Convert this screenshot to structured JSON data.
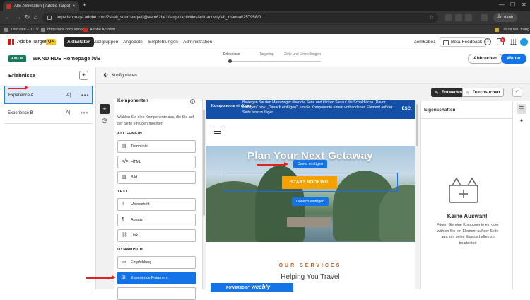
{
  "browser": {
    "tab_title": "Alle Aktivitäten | Adobe Target",
    "url": "experience-qa.adobe.com/?shell_source=qa#/@aem62be1/target/activities/edit-activity/ab_manual/257958/0",
    "profile_label": "Ân danh",
    "bookmarks": [
      "Thư viện – TITV",
      "https://jira.corp.adob...",
      "Adobe Acrobat"
    ],
    "bookmarks_folder": "Tất cả dấu trang"
  },
  "appnav": {
    "product": "Adobe Target",
    "env_badge": "QA",
    "links": [
      "Aktivitäten",
      "Zielgruppen",
      "Angebote",
      "Empfehlungen",
      "Administration"
    ],
    "org": "aem62be1",
    "beta_label": "Beta-Feedback",
    "notification_count": "1"
  },
  "activity": {
    "type_tag": "A/B · M",
    "title": "WKND RDE Homepage A/B",
    "steps": [
      "Erlebnisse",
      "Targeting",
      "Ziele und Einstellungen"
    ],
    "cancel_label": "Abbrechen",
    "next_label": "Weiter"
  },
  "experiences": {
    "title": "Erlebnisse",
    "items": [
      {
        "label": "Experience A",
        "selected": true
      },
      {
        "label": "Experience B",
        "selected": false
      }
    ]
  },
  "toolbar": {
    "configure_label": "Konfigurieren",
    "mode_edit": "Entwerfen",
    "mode_browse": "Durchsuchen"
  },
  "components": {
    "title": "Komponenten",
    "description": "Wählen Sie eine Komponente aus, die Sie auf der Seite einfügen möchten",
    "sections": [
      {
        "name": "ALLGEMEIN",
        "items": [
          "Trennlinie",
          "HTML",
          "Bild"
        ]
      },
      {
        "name": "TEXT",
        "items": [
          "Überschrift",
          "Absatz",
          "Link"
        ]
      },
      {
        "name": "DYNAMISCH",
        "items": [
          "Empfehlung",
          "Experience Fragment"
        ]
      }
    ],
    "highlighted": "Experience Fragment"
  },
  "canvas": {
    "banner_label": "Komponente einfügen",
    "banner_text": "Bewegen Sie den Mauszeiger über die Seite und klicken Sie auf die Schaltfläche „Davor einfügen\" bzw. „Danach einfügen\", um die Komponente einem vorhandenen Element auf der Seite hinzuzufügen.",
    "banner_esc": "ESC",
    "hero_title": "Plan Your Next Getaway",
    "insert_before": "Davor einfügen",
    "cta": "START BOOKING",
    "insert_after": "Danach einfügen",
    "services": "OUR SERVICES",
    "subheading": "Helping You Travel",
    "powered_by": "POWERED BY",
    "weebly": "weebly"
  },
  "properties": {
    "title": "Eigenschaften",
    "empty_heading": "Keine Auswahl",
    "empty_text": "Fügen Sie eine Komponente ein oder wählen Sie ein Element auf der Seite aus, um seine Eigenschaften zu bearbeiten"
  },
  "colors": {
    "accent": "#1473e6",
    "selected_bg": "#dbe8fb",
    "banner": "#1450a8",
    "cta": "#f5a100",
    "annotation": "#e0241b"
  }
}
